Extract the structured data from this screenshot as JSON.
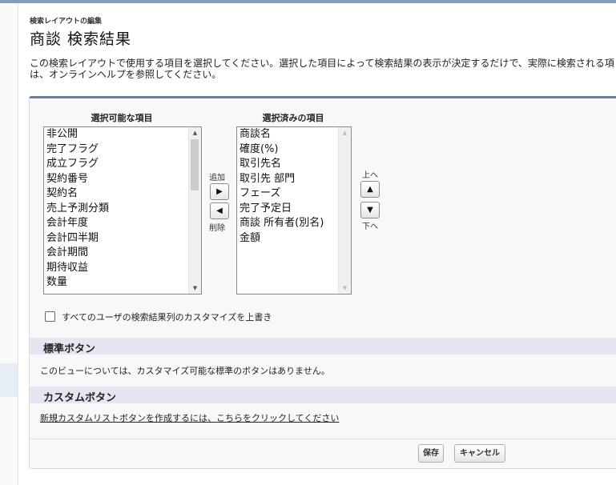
{
  "header": {
    "eyebrow": "検索レイアウトの編集",
    "title": "商談 検索結果",
    "description_line1": "この検索レイアウトで使用する項目を選択してください。選択した項目によって検索結果の表示が決定するだけで、実際に検索される項",
    "description_line2": "は、オンラインヘルプを参照してください。"
  },
  "available": {
    "heading": "選択可能な項目",
    "items": [
      "非公開",
      "完了フラグ",
      "成立フラグ",
      "契約番号",
      "契約名",
      "売上予測分類",
      "会計年度",
      "会計四半期",
      "会計期間",
      "期待収益",
      "数量"
    ]
  },
  "selected": {
    "heading": "選択済みの項目",
    "items": [
      "商談名",
      "確度(%)",
      "取引先名",
      "取引先 部門",
      "フェーズ",
      "完了予定日",
      "商談 所有者(別名)",
      "金額"
    ]
  },
  "controls": {
    "add_label": "追加",
    "remove_label": "削除",
    "up_label": "上へ",
    "down_label": "下へ"
  },
  "override": {
    "label": "すべてのユーザの検索結果列のカスタマイズを上書き",
    "checked": false
  },
  "standard_buttons": {
    "heading": "標準ボタン",
    "text": "このビューについては、カスタマイズ可能な標準のボタンはありません。"
  },
  "custom_buttons": {
    "heading": "カスタムボタン",
    "link": "新規カスタムリストボタンを作成するには、こちらをクリックしてください"
  },
  "footer": {
    "save_label": "保存",
    "cancel_label": "キャンセル"
  },
  "colors": {
    "panel_border_top": "#6d7f93",
    "section_bar": "#e4e6f1",
    "top_bar": "#7f9dbd"
  }
}
